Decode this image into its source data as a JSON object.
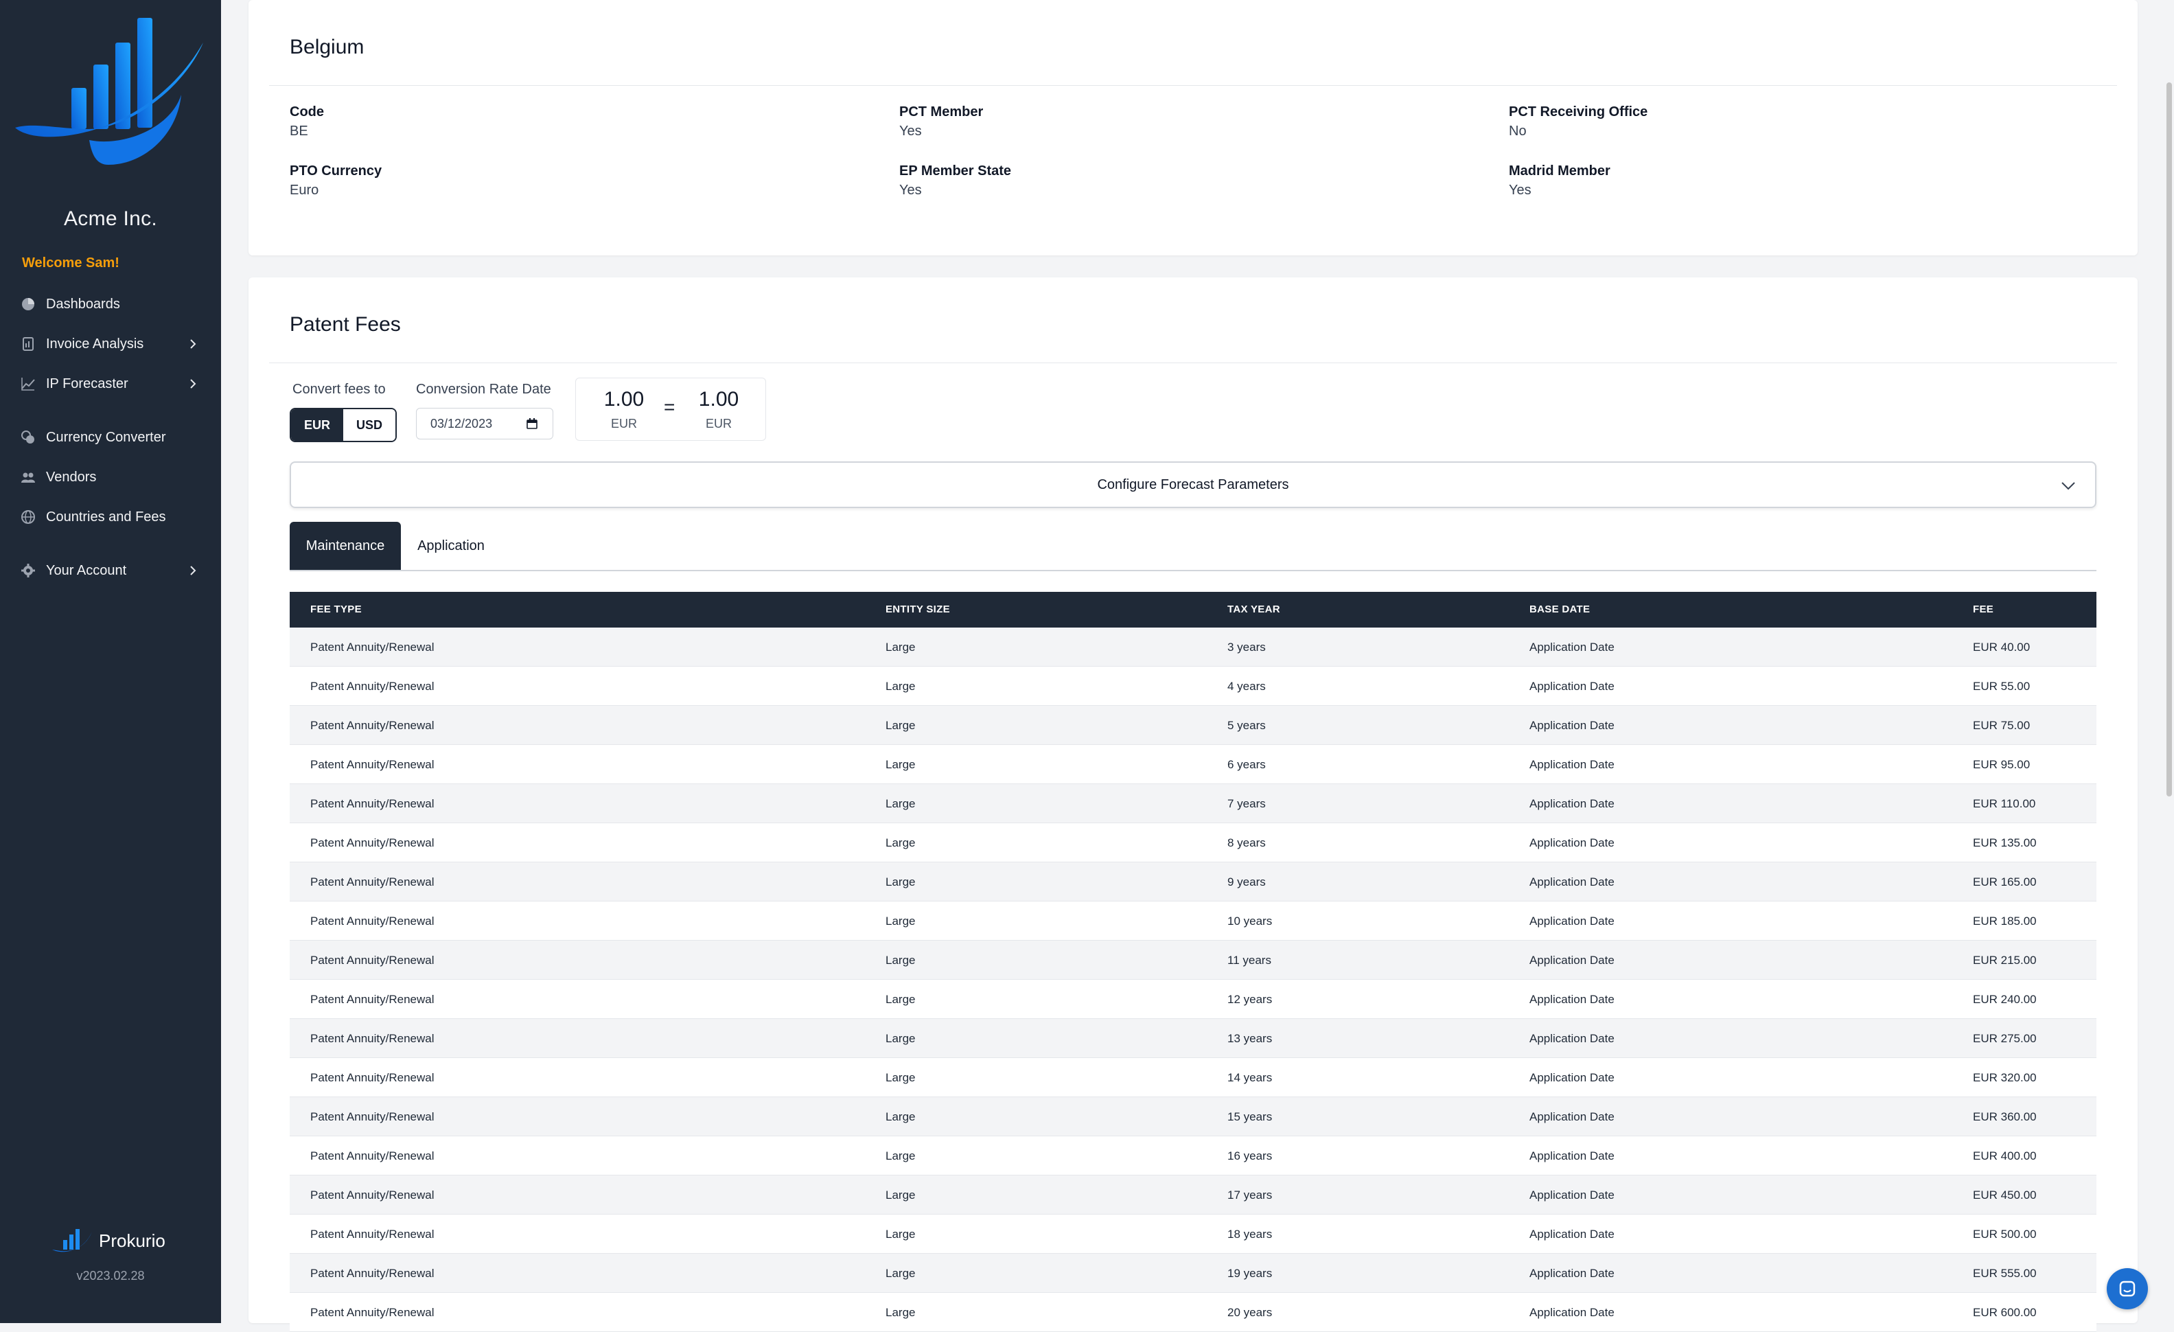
{
  "sidebar": {
    "company": "Acme Inc.",
    "welcome": "Welcome Sam!",
    "items": [
      {
        "label": "Dashboards",
        "icon": "pie-chart-icon",
        "chevron": false
      },
      {
        "label": "Invoice Analysis",
        "icon": "document-icon",
        "chevron": true
      },
      {
        "label": "IP Forecaster",
        "icon": "trend-icon",
        "chevron": true
      },
      {
        "label": "Currency Converter",
        "icon": "coins-icon",
        "chevron": false
      },
      {
        "label": "Vendors",
        "icon": "users-icon",
        "chevron": false
      },
      {
        "label": "Countries and Fees",
        "icon": "globe-icon",
        "chevron": false
      },
      {
        "label": "Your Account",
        "icon": "gear-icon",
        "chevron": true
      }
    ],
    "brand": "Prokurio",
    "version": "v2023.02.28"
  },
  "country": {
    "name": "Belgium",
    "fields": [
      {
        "label": "Code",
        "value": "BE"
      },
      {
        "label": "PCT Member",
        "value": "Yes"
      },
      {
        "label": "PCT Receiving Office",
        "value": "No"
      },
      {
        "label": "PTO Currency",
        "value": "Euro"
      },
      {
        "label": "EP Member State",
        "value": "Yes"
      },
      {
        "label": "Madrid Member",
        "value": "Yes"
      }
    ]
  },
  "fees": {
    "title": "Patent Fees",
    "convert_label": "Convert fees to",
    "currency_options": [
      "EUR",
      "USD"
    ],
    "selected_currency": "EUR",
    "rate_date_label": "Conversion Rate Date",
    "rate_date_value": "03/12/2023",
    "rate": {
      "left_value": "1.00",
      "left_currency": "EUR",
      "equals": "=",
      "right_value": "1.00",
      "right_currency": "EUR"
    },
    "config_label": "Configure Forecast Parameters",
    "tabs": [
      "Maintenance",
      "Application"
    ],
    "active_tab": "Maintenance",
    "columns": [
      "FEE TYPE",
      "ENTITY SIZE",
      "TAX YEAR",
      "BASE DATE",
      "FEE"
    ],
    "rows": [
      [
        "Patent Annuity/Renewal",
        "Large",
        "3 years",
        "Application Date",
        "EUR 40.00"
      ],
      [
        "Patent Annuity/Renewal",
        "Large",
        "4 years",
        "Application Date",
        "EUR 55.00"
      ],
      [
        "Patent Annuity/Renewal",
        "Large",
        "5 years",
        "Application Date",
        "EUR 75.00"
      ],
      [
        "Patent Annuity/Renewal",
        "Large",
        "6 years",
        "Application Date",
        "EUR 95.00"
      ],
      [
        "Patent Annuity/Renewal",
        "Large",
        "7 years",
        "Application Date",
        "EUR 110.00"
      ],
      [
        "Patent Annuity/Renewal",
        "Large",
        "8 years",
        "Application Date",
        "EUR 135.00"
      ],
      [
        "Patent Annuity/Renewal",
        "Large",
        "9 years",
        "Application Date",
        "EUR 165.00"
      ],
      [
        "Patent Annuity/Renewal",
        "Large",
        "10 years",
        "Application Date",
        "EUR 185.00"
      ],
      [
        "Patent Annuity/Renewal",
        "Large",
        "11 years",
        "Application Date",
        "EUR 215.00"
      ],
      [
        "Patent Annuity/Renewal",
        "Large",
        "12 years",
        "Application Date",
        "EUR 240.00"
      ],
      [
        "Patent Annuity/Renewal",
        "Large",
        "13 years",
        "Application Date",
        "EUR 275.00"
      ],
      [
        "Patent Annuity/Renewal",
        "Large",
        "14 years",
        "Application Date",
        "EUR 320.00"
      ],
      [
        "Patent Annuity/Renewal",
        "Large",
        "15 years",
        "Application Date",
        "EUR 360.00"
      ],
      [
        "Patent Annuity/Renewal",
        "Large",
        "16 years",
        "Application Date",
        "EUR 400.00"
      ],
      [
        "Patent Annuity/Renewal",
        "Large",
        "17 years",
        "Application Date",
        "EUR 450.00"
      ],
      [
        "Patent Annuity/Renewal",
        "Large",
        "18 years",
        "Application Date",
        "EUR 500.00"
      ],
      [
        "Patent Annuity/Renewal",
        "Large",
        "19 years",
        "Application Date",
        "EUR 555.00"
      ],
      [
        "Patent Annuity/Renewal",
        "Large",
        "20 years",
        "Application Date",
        "EUR 600.00"
      ]
    ]
  },
  "colors": {
    "sidebar": "#1f2937",
    "accent": "#f59e0b",
    "brand_blue": "#1d6fd1"
  }
}
